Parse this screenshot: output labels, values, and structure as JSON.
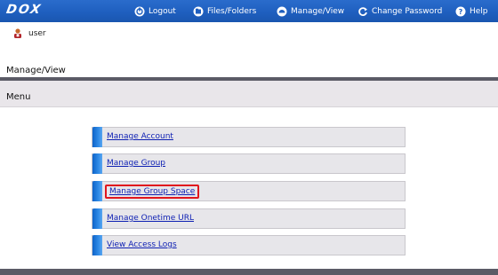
{
  "app": {
    "logo_text": "DOX",
    "brand_color": "#1f5fbf"
  },
  "nav": {
    "logout": {
      "label": "Logout",
      "icon": "logout-icon"
    },
    "files": {
      "label": "Files/Folders",
      "icon": "folders-icon"
    },
    "manage": {
      "label": "Manage/View",
      "icon": "manage-icon"
    },
    "password": {
      "label": "Change Password",
      "icon": "refresh-icon"
    },
    "help": {
      "label": "Help",
      "icon": "help-icon"
    }
  },
  "user": {
    "name": "user",
    "icon": "user-icon"
  },
  "page": {
    "section_title": "Manage/View",
    "menu_title": "Menu"
  },
  "menu": {
    "items": [
      {
        "label": "Manage Account",
        "selected": false
      },
      {
        "label": "Manage Group",
        "selected": false
      },
      {
        "label": "Manage Group Space",
        "selected": true
      },
      {
        "label": "Manage Onetime URL",
        "selected": false
      },
      {
        "label": "View Access Logs",
        "selected": false
      }
    ],
    "highlight_color": "#e0161e",
    "link_color": "#0d1fb3"
  }
}
